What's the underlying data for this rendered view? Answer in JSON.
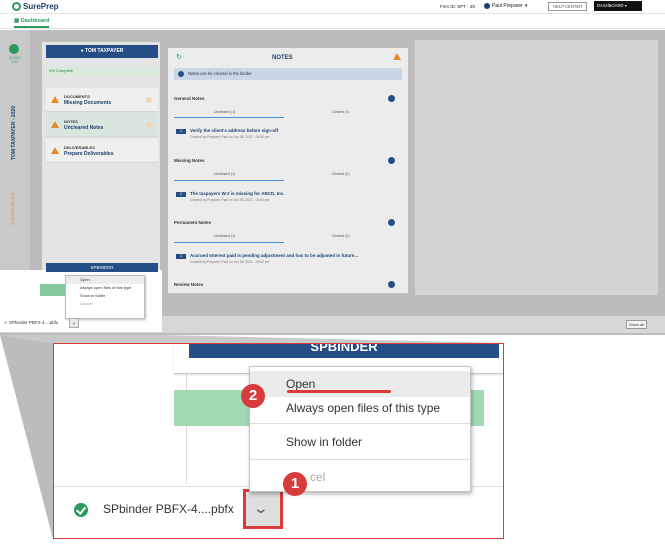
{
  "app": {
    "logo": "SurePrep",
    "firm_id": "Firm ID: SPT - 29",
    "user": "Paul Preparer",
    "help": "HELP CENTER",
    "dashboard": "DASHBOARD",
    "tab": "Dashboard"
  },
  "sidebar": {
    "client_label": "CLIENT LIST",
    "vertical_title": "TOM TAXPAYER - 2020",
    "vertical_status": "IN-OFFICE REVIEW"
  },
  "client": {
    "button": "TOM TAXPAYER",
    "complete": "0% Complete",
    "items": [
      {
        "title": "DOCUMENTS",
        "subtitle": "Missing Documents",
        "count": "0"
      },
      {
        "title": "NOTES",
        "subtitle": "Uncleared Notes",
        "count": "3"
      },
      {
        "title": "DELIVERABLES",
        "subtitle": "Prepare Deliverables",
        "count": ""
      }
    ],
    "spbinder": "SPBINDER"
  },
  "notes": {
    "title": "NOTES",
    "info": "Notes can be cleared in the binder",
    "sections": [
      {
        "title": "General Notes",
        "uncleared": "Uncleared (1)",
        "cleared": "Cleared (0)",
        "num": "1",
        "text": "Verify the client's address before sign-off",
        "meta": "Created by Preparer, Paul on Jun 08, 2021 - 04:59 pm"
      },
      {
        "title": "Missing Notes",
        "uncleared": "Uncleared (1)",
        "cleared": "Cleared (0)",
        "num": "2",
        "text": "The taxpayers W-2 is missing for ABCD, Inc.",
        "meta": "Created by Preparer, Paul on Jun 08, 2021 - 05:00 pm"
      },
      {
        "title": "Permanent Notes",
        "uncleared": "Uncleared (1)",
        "cleared": "Cleared (0)",
        "num": "1",
        "text": "Accrued Interest paid is pending adjustment and has to be adjusted in future...",
        "meta": "Created by Preparer, Paul on Jun 08, 2021 - 05:02 pm"
      },
      {
        "title": "Review Notes",
        "uncleared": "",
        "cleared": "",
        "num": "",
        "text": "",
        "meta": ""
      }
    ]
  },
  "download_shelf": {
    "file": "SPbinder PBFX-4....pbfx",
    "show_all": "Show all",
    "menu": [
      "Open",
      "Always open files of this type",
      "Show in folder",
      "Cancel"
    ]
  },
  "inset": {
    "spbinder": "SPBINDER",
    "file": "SPbinder PBFX-4....pbfx",
    "menu": [
      "Open",
      "Always open files of this type",
      "Show in folder",
      "Cancel"
    ],
    "cancel_visible": "cel",
    "badges": [
      "1",
      "2"
    ]
  },
  "colors": {
    "brand_blue": "#254d86",
    "brand_green": "#2c9a5d",
    "warn": "#e48a2a",
    "annotation_red": "#d73b3b"
  }
}
